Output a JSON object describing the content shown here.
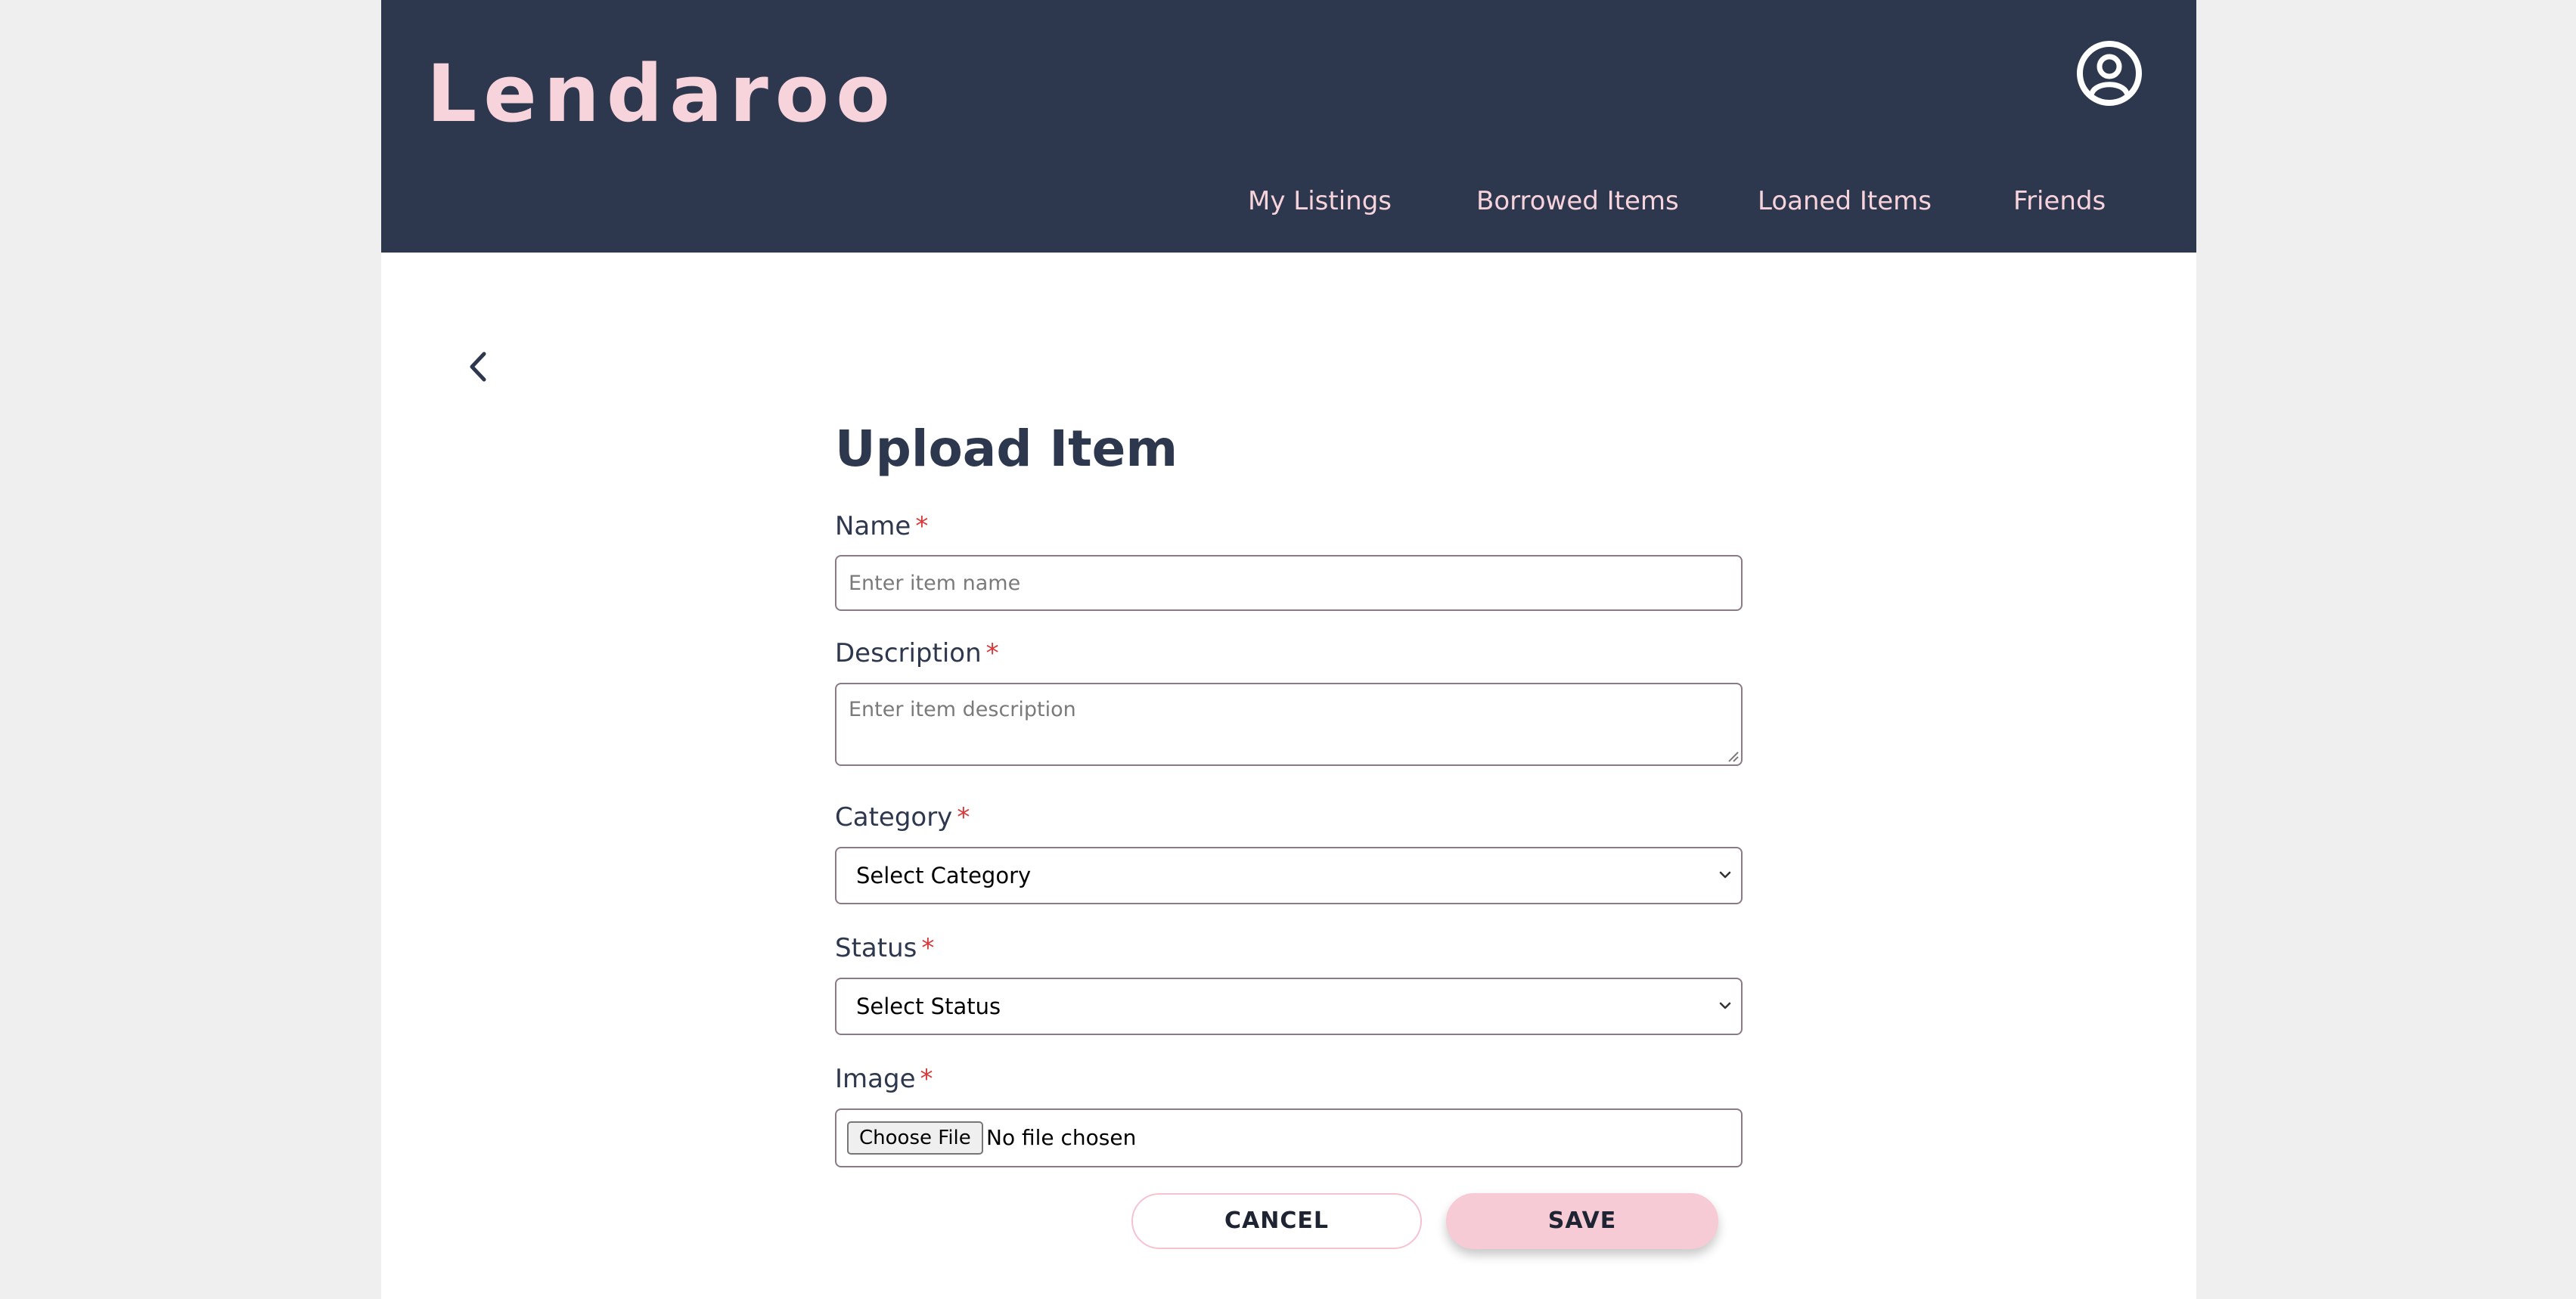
{
  "app": {
    "logo": "Lendaroo"
  },
  "header": {
    "profile_icon": "user-circle-icon",
    "nav": [
      {
        "label": "My Listings"
      },
      {
        "label": "Borrowed Items"
      },
      {
        "label": "Loaned Items"
      },
      {
        "label": "Friends"
      }
    ]
  },
  "page": {
    "back_icon": "chevron-left-icon",
    "title": "Upload Item"
  },
  "form": {
    "required_marker": "*",
    "name": {
      "label": "Name",
      "value": "",
      "placeholder": "Enter item name"
    },
    "description": {
      "label": "Description",
      "value": "",
      "placeholder": "Enter item description"
    },
    "category": {
      "label": "Category",
      "selected": "Select Category"
    },
    "status": {
      "label": "Status",
      "selected": "Select Status"
    },
    "image": {
      "label": "Image",
      "button_label": "Choose File",
      "file_status": "No file chosen"
    }
  },
  "actions": {
    "cancel_label": "CANCEL",
    "save_label": "SAVE"
  },
  "colors": {
    "header_bg": "#2d374d",
    "accent_pink": "#f7cbd5",
    "required_red": "#d9383a",
    "text_dark": "#2d374d"
  }
}
